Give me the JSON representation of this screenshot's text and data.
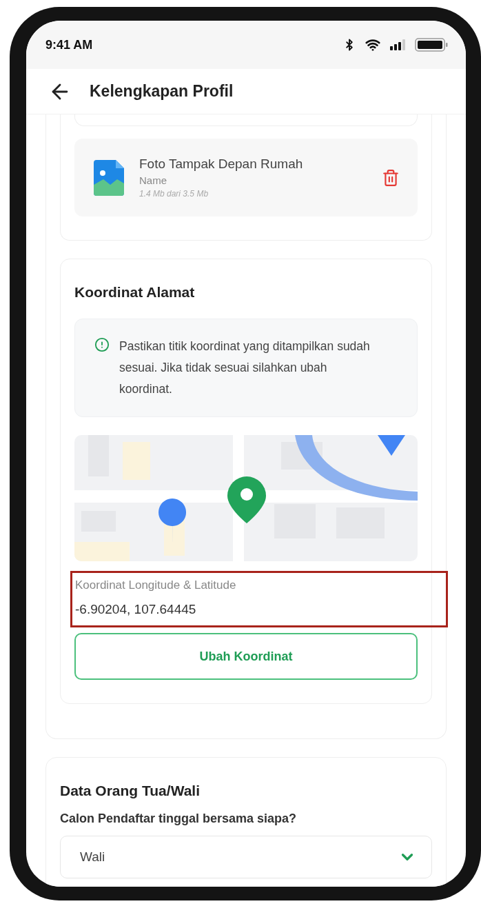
{
  "status_bar": {
    "time": "9:41 AM"
  },
  "header": {
    "title": "Kelengkapan Profil"
  },
  "upload": {
    "title": "Foto Tampak Depan Rumah",
    "name": "Name",
    "size": "1.4 Mb dari 3.5 Mb"
  },
  "coordinates": {
    "title": "Koordinat Alamat",
    "notice": "Pastikan titik koordinat yang ditampilkan sudah sesuai. Jika tidak sesuai silahkan ubah koordinat.",
    "field_label": "Koordinat Longitude & Latitude",
    "value": "-6.90204, 107.64445",
    "button": "Ubah Koordinat"
  },
  "guardian": {
    "title": "Data Orang Tua/Wali",
    "question": "Calon Pendaftar tinggal bersama siapa?",
    "select": {
      "value": "Wali"
    }
  }
}
